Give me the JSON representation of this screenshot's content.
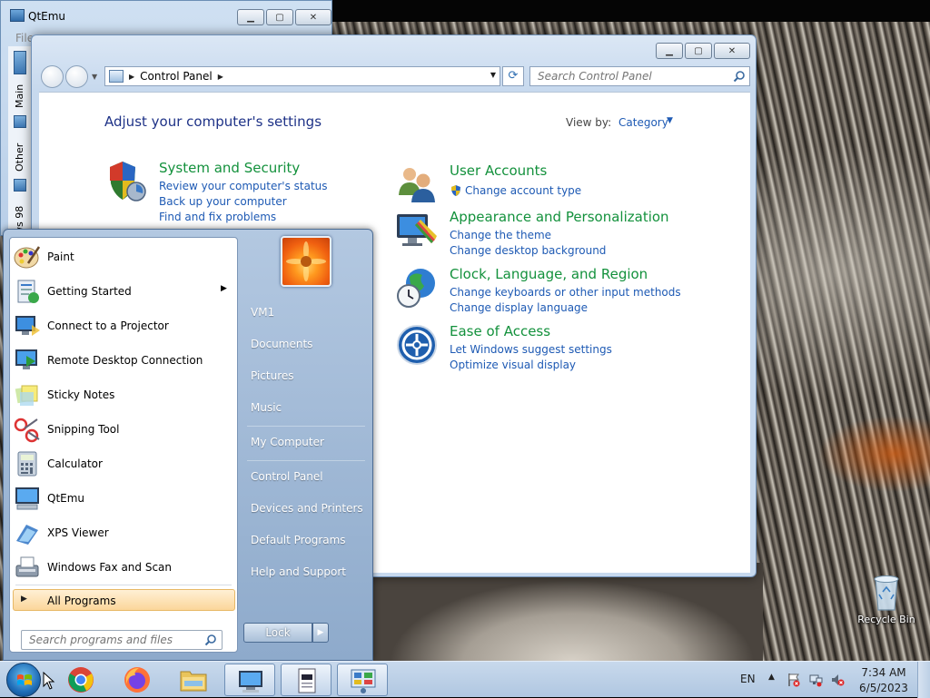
{
  "desktop": {
    "recycle_bin_label": "Recycle Bin"
  },
  "qtemu": {
    "title": "QtEmu",
    "menubar_text": "File",
    "side_tabs": [
      "Main",
      "Other",
      "ws 98"
    ]
  },
  "control_panel": {
    "address": {
      "crumb": "Control Panel"
    },
    "search_placeholder": "Search Control Panel",
    "heading": "Adjust your computer's settings",
    "view_by_label": "View by:",
    "view_by_value": "Category",
    "categories": [
      {
        "title": "System and Security",
        "icon": "shield-icon",
        "links": [
          "Review your computer's status",
          "Back up your computer",
          "Find and fix problems"
        ]
      },
      {
        "title": "User Accounts",
        "icon": "users-icon",
        "links": [
          "Change account type"
        ]
      },
      {
        "title": "Appearance and Personalization",
        "icon": "monitor-palette-icon",
        "links": [
          "Change the theme",
          "Change desktop background"
        ]
      },
      {
        "title": "Clock, Language, and Region",
        "icon": "globe-clock-icon",
        "links": [
          "Change keyboards or other input methods",
          "Change display language"
        ]
      },
      {
        "title": "Ease of Access",
        "icon": "ease-of-access-icon",
        "links": [
          "Let Windows suggest settings",
          "Optimize visual display"
        ]
      }
    ]
  },
  "start_menu": {
    "programs": [
      {
        "label": "Paint",
        "icon": "paint-icon"
      },
      {
        "label": "Getting Started",
        "icon": "getting-started-icon",
        "has_submenu": true
      },
      {
        "label": "Connect to a Projector",
        "icon": "projector-icon"
      },
      {
        "label": "Remote Desktop Connection",
        "icon": "remote-desktop-icon"
      },
      {
        "label": "Sticky Notes",
        "icon": "sticky-notes-icon"
      },
      {
        "label": "Snipping Tool",
        "icon": "scissors-icon"
      },
      {
        "label": "Calculator",
        "icon": "calculator-icon"
      },
      {
        "label": "QtEmu",
        "icon": "qtemu-icon"
      },
      {
        "label": "XPS Viewer",
        "icon": "xps-viewer-icon"
      },
      {
        "label": "Windows Fax and Scan",
        "icon": "fax-icon"
      }
    ],
    "all_programs": "All Programs",
    "search_placeholder": "Search programs and files",
    "right_items": [
      "VM1",
      "Documents",
      "Pictures",
      "Music",
      "My Computer",
      "Control Panel",
      "Devices and Printers",
      "Default Programs",
      "Help and Support"
    ],
    "lock_label": "Lock"
  },
  "taskbar": {
    "pinned": [
      "chrome-icon",
      "firefox-icon",
      "file-explorer-icon",
      "qtemu-icon",
      "notepad-icon",
      "control-panel-icon"
    ],
    "language": "EN",
    "time": "7:34 AM",
    "date": "6/5/2023"
  }
}
